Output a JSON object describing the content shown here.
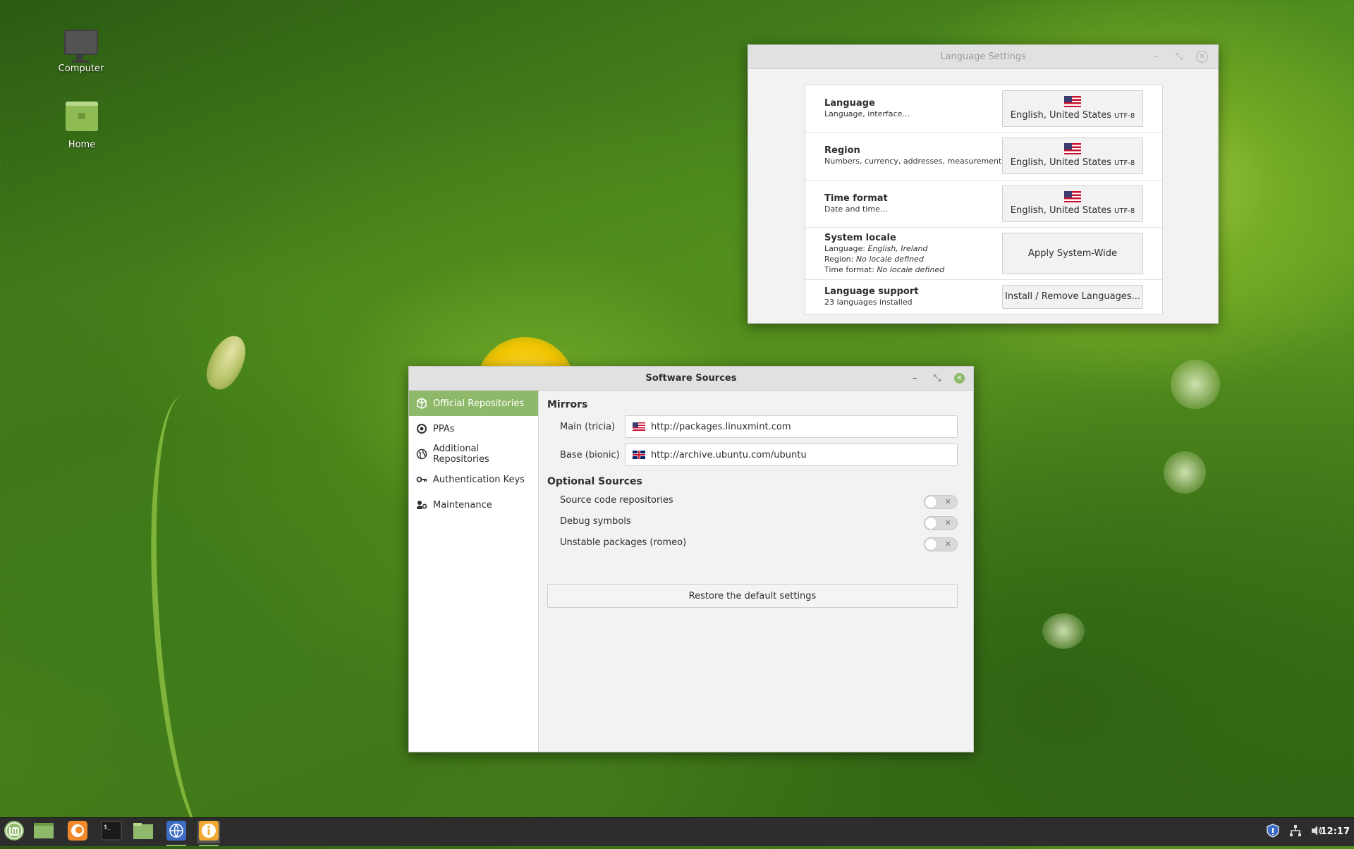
{
  "desktop": {
    "icons": [
      {
        "label": "Computer",
        "icon": "computer-icon"
      },
      {
        "label": "Home",
        "icon": "home-folder-icon"
      }
    ]
  },
  "language_window": {
    "title": "Language Settings",
    "rows": [
      {
        "title": "Language",
        "subtitle": "Language, interface...",
        "button": "English, United States",
        "encoding": "UTF-8"
      },
      {
        "title": "Region",
        "subtitle": "Numbers, currency, addresses, measurement...",
        "button": "English, United States",
        "encoding": "UTF-8"
      },
      {
        "title": "Time format",
        "subtitle": "Date and time...",
        "button": "English, United States",
        "encoding": "UTF-8"
      }
    ],
    "system_locale": {
      "title": "System locale",
      "language_label": "Language:",
      "language_value": "English, Ireland",
      "region_label": "Region:",
      "region_value": "No locale defined",
      "time_label": "Time format:",
      "time_value": "No locale defined",
      "button": "Apply System-Wide"
    },
    "language_support": {
      "title": "Language support",
      "subtitle": "23 languages installed",
      "button": "Install / Remove Languages..."
    }
  },
  "software_window": {
    "title": "Software Sources",
    "sidebar": [
      {
        "label": "Official Repositories",
        "icon": "package-icon",
        "active": true
      },
      {
        "label": "PPAs",
        "icon": "ppa-icon",
        "active": false
      },
      {
        "label": "Additional Repositories",
        "icon": "globe-icon",
        "active": false
      },
      {
        "label": "Authentication Keys",
        "icon": "key-icon",
        "active": false
      },
      {
        "label": "Maintenance",
        "icon": "maintenance-icon",
        "active": false
      }
    ],
    "mirrors": {
      "heading": "Mirrors",
      "main_label": "Main (tricia)",
      "main_url": "http://packages.linuxmint.com",
      "base_label": "Base (bionic)",
      "base_url": "http://archive.ubuntu.com/ubuntu"
    },
    "optional": {
      "heading": "Optional Sources",
      "items": [
        {
          "label": "Source code repositories",
          "enabled": false
        },
        {
          "label": "Debug symbols",
          "enabled": false
        },
        {
          "label": "Unstable packages (romeo)",
          "enabled": false
        }
      ]
    },
    "restore_button": "Restore the default settings"
  },
  "taskbar": {
    "clock": "12:17",
    "apps": [
      "mint-menu-icon",
      "show-desktop-icon",
      "firefox-icon",
      "terminal-icon",
      "files-icon",
      "language-settings-icon",
      "software-sources-icon"
    ]
  },
  "colors": {
    "accent": "#8fb96a",
    "taskbar": "#2d2d2d"
  }
}
